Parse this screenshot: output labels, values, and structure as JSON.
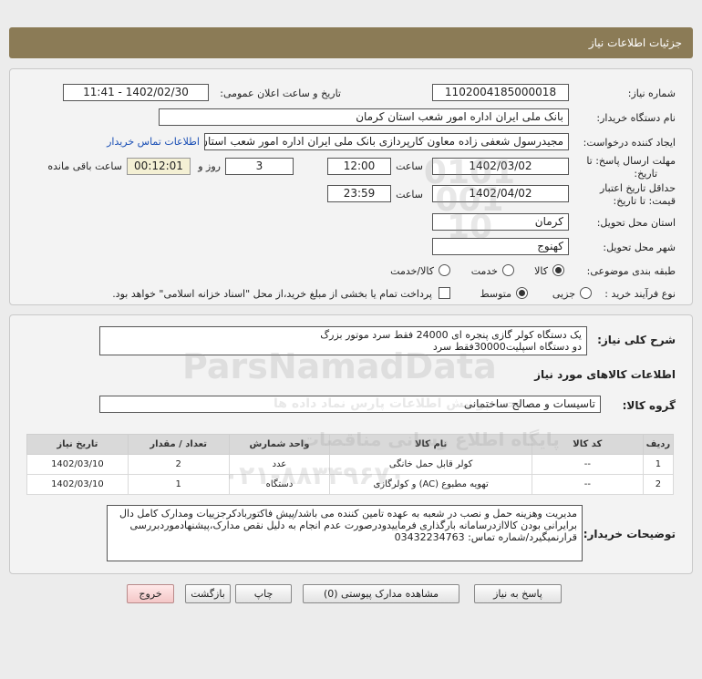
{
  "header": {
    "title": "جزئیات اطلاعات نیاز"
  },
  "info": {
    "need_number_label": "شماره نیاز:",
    "need_number": "1102004185000018",
    "announce_label": "تاریخ و ساعت اعلان عمومی:",
    "announce_value": "1402/02/30 - 11:41",
    "buyer_org_label": "نام دستگاه خریدار:",
    "buyer_org": "بانک ملی ایران اداره امور شعب استان کرمان",
    "requester_label": "ایجاد کننده درخواست:",
    "requester": "مجیدرسول شعفی زاده معاون کارپردازی بانک ملی ایران اداره امور شعب استان کرمان",
    "contact_link": "اطلاعات تماس خریدار",
    "deadline_label_1": "مهلت ارسال پاسخ: تا",
    "deadline_label_2": "تاریخ:",
    "deadline_date": "1402/03/02",
    "time_label": "ساعت",
    "deadline_time": "12:00",
    "days_value": "3",
    "days_label": "روز و",
    "remaining_time": "00:12:01",
    "remaining_label": "ساعت باقی مانده",
    "validity_label_1": "حداقل تاریخ اعتبار",
    "validity_label_2": "قیمت: تا تاریخ:",
    "validity_date": "1402/04/02",
    "validity_time": "23:59",
    "province_label": "استان محل تحویل:",
    "province": "کرمان",
    "city_label": "شهر محل تحویل:",
    "city": "کهنوج",
    "category_label": "طبقه بندی موضوعی:",
    "category_options": [
      "کالا",
      "خدمت",
      "کالا/خدمت"
    ],
    "category_selected": "کالا",
    "process_label": "نوع فرآیند خرید :",
    "process_options": [
      "جزیی",
      "متوسط"
    ],
    "process_selected": "متوسط",
    "payment_note": "پرداخت تمام یا بخشی از مبلغ خرید،از محل \"اسناد خزانه اسلامی\" خواهد بود."
  },
  "goods": {
    "summary_label": "شرح کلی نیاز:",
    "summary_line1": "یک دستگاه کولر گازی پنجره ای 24000 فقط سرد موتور بزرگ",
    "summary_line2": "دو دستگاه اسپلیت30000فقط سرد",
    "section_title": "اطلاعات کالاهای مورد نیاز",
    "group_label": "گروه کالا:",
    "group_value": "تاسیسات و مصالح ساختمانی",
    "columns": [
      "ردیف",
      "کد کالا",
      "نام کالا",
      "واحد شمارش",
      "تعداد / مقدار",
      "تاریخ نیاز"
    ],
    "rows": [
      [
        "1",
        "--",
        "کولر قابل حمل خانگی",
        "عدد",
        "2",
        "1402/03/10"
      ],
      [
        "2",
        "--",
        "تهویه مطبوع (AC) و کولرگازی",
        "دستگاه",
        "1",
        "1402/03/10"
      ]
    ],
    "buyer_notes_label": "توضیحات خریدار:",
    "buyer_notes": "مدیریت وهزینه حمل و نصب در شعبه به عهده تامین کننده می باشد/پیش فاکتوربادکرجزییات ومدارک کامل دال برایرانی بودن کالاازدرسامانه بارگذاری فرماییدودرصورت عدم انجام به دلیل نقص مدارک،پیشنهادموردبررسی قرارنمیگیرد/شماره تماس: 03432234763"
  },
  "buttons": {
    "reply": "پاسخ به نیاز",
    "attachments": "مشاهده مدارک پیوستی (0)",
    "print": "چاپ",
    "back": "بازگشت",
    "exit": "خروج"
  },
  "watermark": {
    "brand": "ParsNamadData",
    "digits": "0101 001 10",
    "fa_line1": "پایگاه اطلاع رسانی مناقصات",
    "fa_line2": "۰۲۱-۸۸۳۴۹۶۷۰",
    "fa_line3": "تحت پوشش اطلاعات پارس نماد داده ها"
  },
  "colors": {
    "header": "#8b7b56",
    "link": "#1a4fb5",
    "exit_button": "#f4c7c7"
  }
}
